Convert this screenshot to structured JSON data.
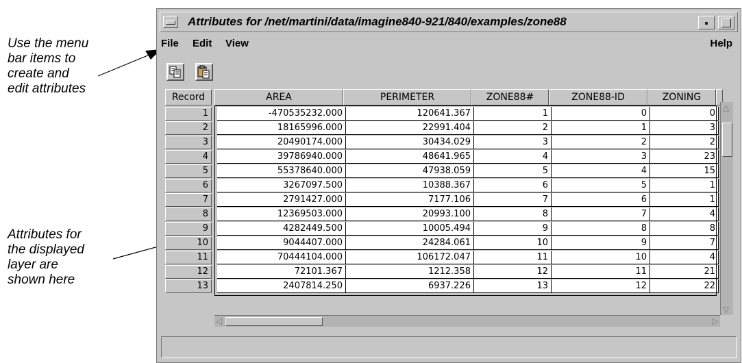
{
  "callouts": [
    "Use the menu\nbar items to\ncreate and\nedit attributes",
    "Attributes for\nthe displayed\nlayer are\nshown here"
  ],
  "window": {
    "title": "Attributes for /net/martini/data/imagine840-921/840/examples/zone88"
  },
  "menu": {
    "file": "File",
    "edit": "Edit",
    "view": "View",
    "help": "Help"
  },
  "toolbar": {
    "copy_icon": "copy-icon",
    "paste_icon": "paste-icon"
  },
  "table": {
    "columns": [
      "Record",
      "AREA",
      "PERIMETER",
      "ZONE88#",
      "ZONE88-ID",
      "ZONING"
    ],
    "rows": [
      [
        "1",
        "-470535232.000",
        "120641.367",
        "1",
        "0",
        "0"
      ],
      [
        "2",
        "18165996.000",
        "22991.404",
        "2",
        "1",
        "3"
      ],
      [
        "3",
        "20490174.000",
        "30434.029",
        "3",
        "2",
        "2"
      ],
      [
        "4",
        "39786940.000",
        "48641.965",
        "4",
        "3",
        "23"
      ],
      [
        "5",
        "55378640.000",
        "47938.059",
        "5",
        "4",
        "15"
      ],
      [
        "6",
        "3267097.500",
        "10388.367",
        "6",
        "5",
        "1"
      ],
      [
        "7",
        "2791427.000",
        "7177.106",
        "7",
        "6",
        "1"
      ],
      [
        "8",
        "12369503.000",
        "20993.100",
        "8",
        "7",
        "4"
      ],
      [
        "9",
        "4282449.500",
        "10005.494",
        "9",
        "8",
        "8"
      ],
      [
        "10",
        "9044407.000",
        "24284.061",
        "10",
        "9",
        "7"
      ],
      [
        "11",
        "70444104.000",
        "106172.047",
        "11",
        "10",
        "4"
      ],
      [
        "12",
        "72101.367",
        "1212.358",
        "12",
        "11",
        "21"
      ],
      [
        "13",
        "2407814.250",
        "6937.226",
        "13",
        "12",
        "22"
      ]
    ]
  }
}
